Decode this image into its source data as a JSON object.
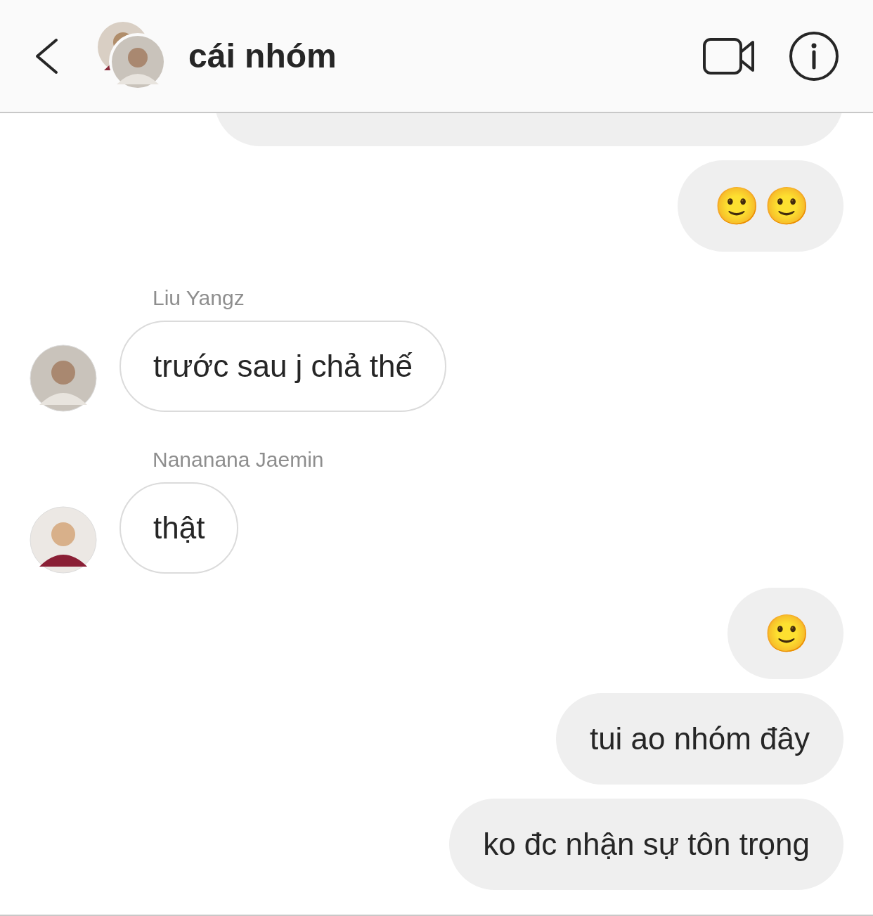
{
  "header": {
    "title": "cái nhóm"
  },
  "messages": [
    {
      "kind": "cut_off"
    },
    {
      "kind": "outgoing",
      "text": "🙂 🙂",
      "emoji": true
    },
    {
      "kind": "incoming",
      "sender": "Liu Yangz",
      "text": "trước sau j chả thế"
    },
    {
      "kind": "incoming",
      "sender": "Nananana Jaemin",
      "text": "thật"
    },
    {
      "kind": "outgoing",
      "text": "🙂",
      "emoji": true
    },
    {
      "kind": "outgoing",
      "text": "tui ao nhóm đây",
      "emoji": false
    },
    {
      "kind": "outgoing",
      "text": "ko đc nhận sự tôn trọng",
      "emoji": false
    }
  ]
}
